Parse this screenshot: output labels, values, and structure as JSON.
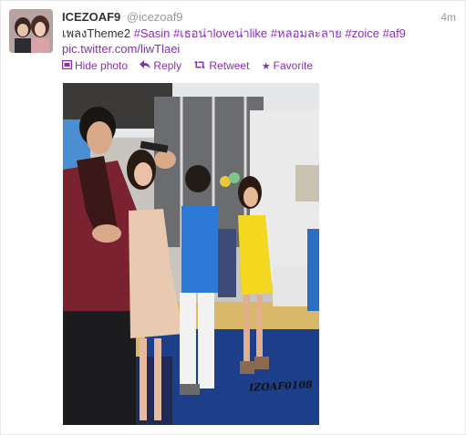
{
  "tweet": {
    "display_name": "ICEZOAF9",
    "handle": "@icezoaf9",
    "timestamp": "4m",
    "text": {
      "prefix": "เพลงTheme2 ",
      "hashtags": [
        "#Sasin",
        "#เธอน่าloveน่าlike",
        "#หลอมละลาย",
        "#zoice",
        "#af9"
      ],
      "link": "pic.twitter.com/liwTlaei"
    },
    "actions": {
      "hide_photo": "Hide photo",
      "reply": "Reply",
      "retweet": "Retweet",
      "favorite": "Favorite"
    },
    "photo": {
      "watermark": "IZOAF0108"
    }
  },
  "colors": {
    "link": "#8b2dba",
    "muted": "#999999",
    "text": "#333333"
  },
  "icons": {
    "hide_photo": "photo-icon",
    "reply": "reply-arrow-icon",
    "retweet": "retweet-icon",
    "favorite": "star-icon"
  }
}
